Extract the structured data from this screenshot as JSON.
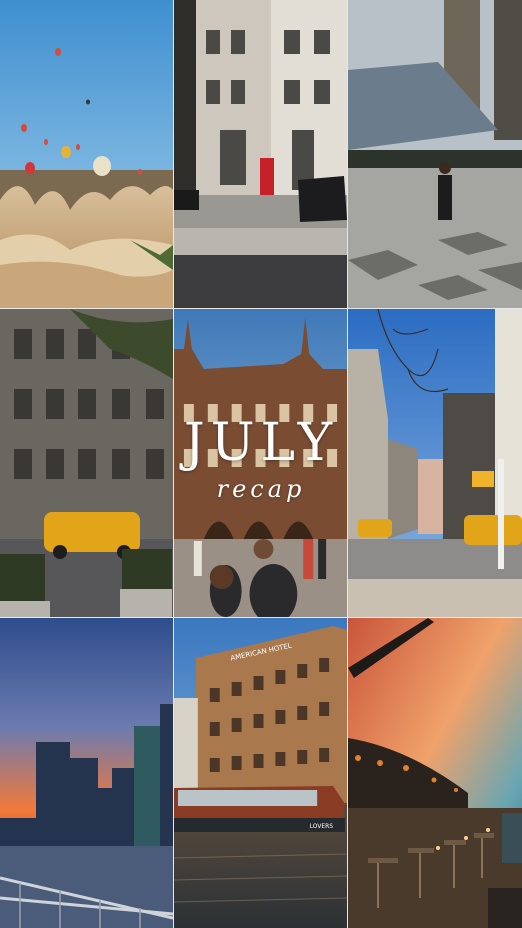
{
  "title": {
    "main": "JULY",
    "script": "recap"
  },
  "tiles": [
    {
      "scene": "hot-air-balloons-over-rock-formations"
    },
    {
      "scene": "london-street-with-red-phone-box"
    },
    {
      "scene": "modern-plaza-with-skyscraper"
    },
    {
      "scene": "ornate-building-with-yellow-taxi"
    },
    {
      "scene": "gothic-building-with-crowd"
    },
    {
      "scene": "city-street-with-bare-tree-and-taxi"
    },
    {
      "scene": "manhattan-skyline-at-sunset"
    },
    {
      "scene": "amsterdam-hotel-and-canal-boat"
    },
    {
      "scene": "waterfront-terrace-restaurant-at-dusk"
    }
  ],
  "signs": {
    "hotel": "AMERICAN HOTEL",
    "boat": "LOVERS"
  },
  "colors": {
    "accent_red": "#c8202a",
    "taxi_yellow": "#e2a51a",
    "sunset_orange": "#f07a3a"
  }
}
